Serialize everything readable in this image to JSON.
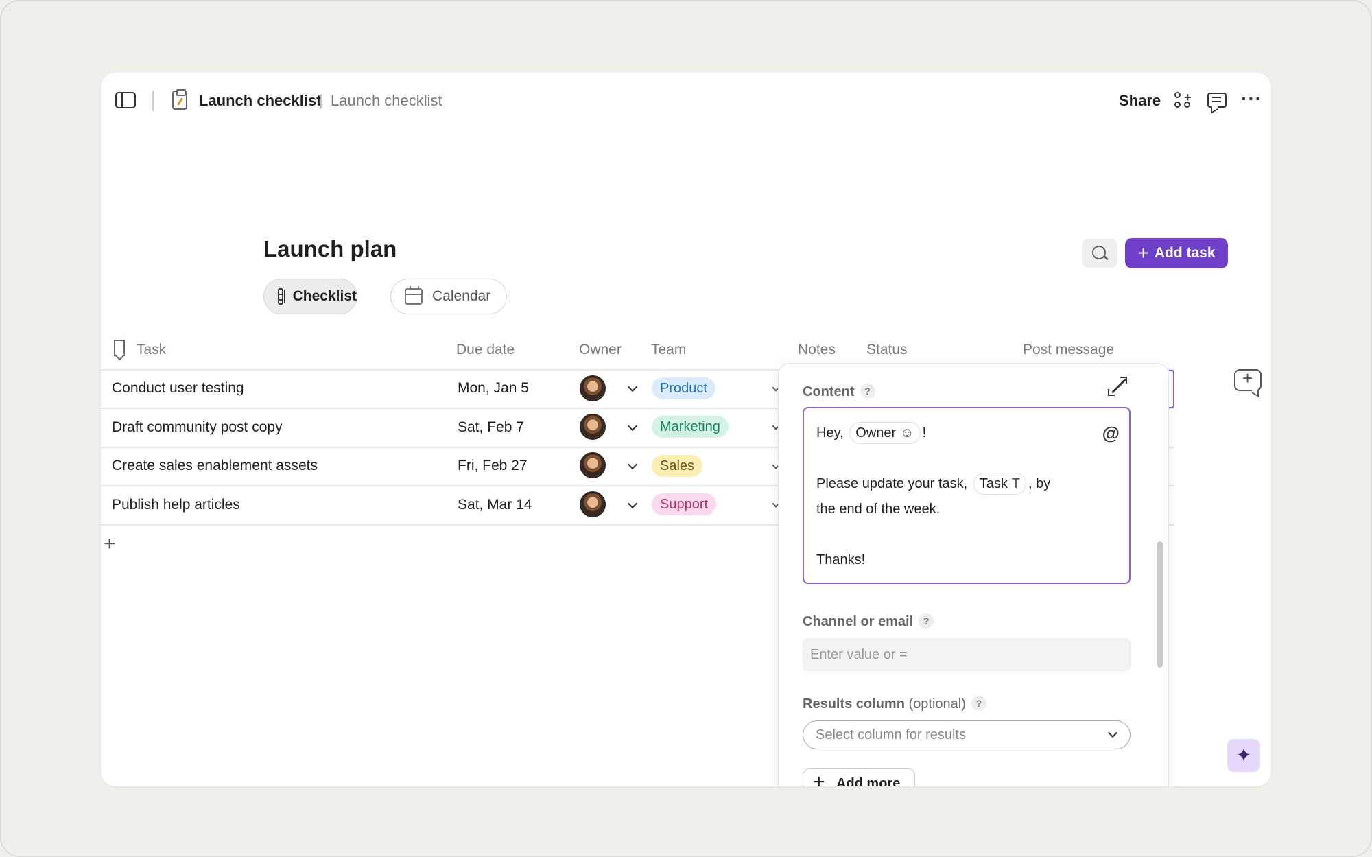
{
  "colors": {
    "accent": "#6f3fc8",
    "background": "#f0efea",
    "product_bg": "#dcecfb",
    "product_fg": "#1d6fb8",
    "marketing_bg": "#d4f3e4",
    "marketing_fg": "#17805a",
    "sales_bg": "#fbefb6",
    "sales_fg": "#6b5410",
    "support_bg": "#fbd9ec",
    "support_fg": "#b0346f"
  },
  "header": {
    "doc_title": "Launch checklist",
    "separator": "|",
    "doc_subtitle": "Launch checklist",
    "share_label": "Share",
    "more_label": "···"
  },
  "page": {
    "title": "Launch plan",
    "tabs": [
      {
        "label": "Checklist",
        "icon": "table-icon",
        "active": true
      },
      {
        "label": "Calendar",
        "icon": "calendar-icon",
        "active": false
      }
    ],
    "add_task_label": "Add task",
    "add_task_plus": "+"
  },
  "table": {
    "columns": [
      "Task",
      "Due date",
      "Owner",
      "Team",
      "Notes",
      "Status",
      "Post message"
    ],
    "rows": [
      {
        "task": "Conduct user testing",
        "due": "Mon, Jan 5",
        "team": "Product"
      },
      {
        "task": "Draft community post copy",
        "due": "Sat, Feb 7",
        "team": "Marketing"
      },
      {
        "task": "Create sales enablement assets",
        "due": "Fri, Feb 27",
        "team": "Sales"
      },
      {
        "task": "Publish help articles",
        "due": "Sat, Mar 14",
        "team": "Support"
      }
    ],
    "add_row_label": "+"
  },
  "panel": {
    "content_label": "Content",
    "help_mark": "?",
    "message": {
      "greeting": "Hey,",
      "owner_chip": "Owner",
      "owner_chip_icon": "person-icon",
      "greeting_end": "!",
      "line2_start": "Please update your task,",
      "task_chip": "Task",
      "task_chip_icon": "T",
      "line2_end": ", by",
      "line3": "the end of the week.",
      "line4": "Thanks!",
      "mention_icon": "@"
    },
    "channel_label": "Channel or email",
    "channel_placeholder": "Enter value or =",
    "results_label": "Results column",
    "results_optional": "(optional)",
    "results_placeholder": "Select column for results",
    "add_more_label": "Add more"
  },
  "ai_icon": "✦"
}
